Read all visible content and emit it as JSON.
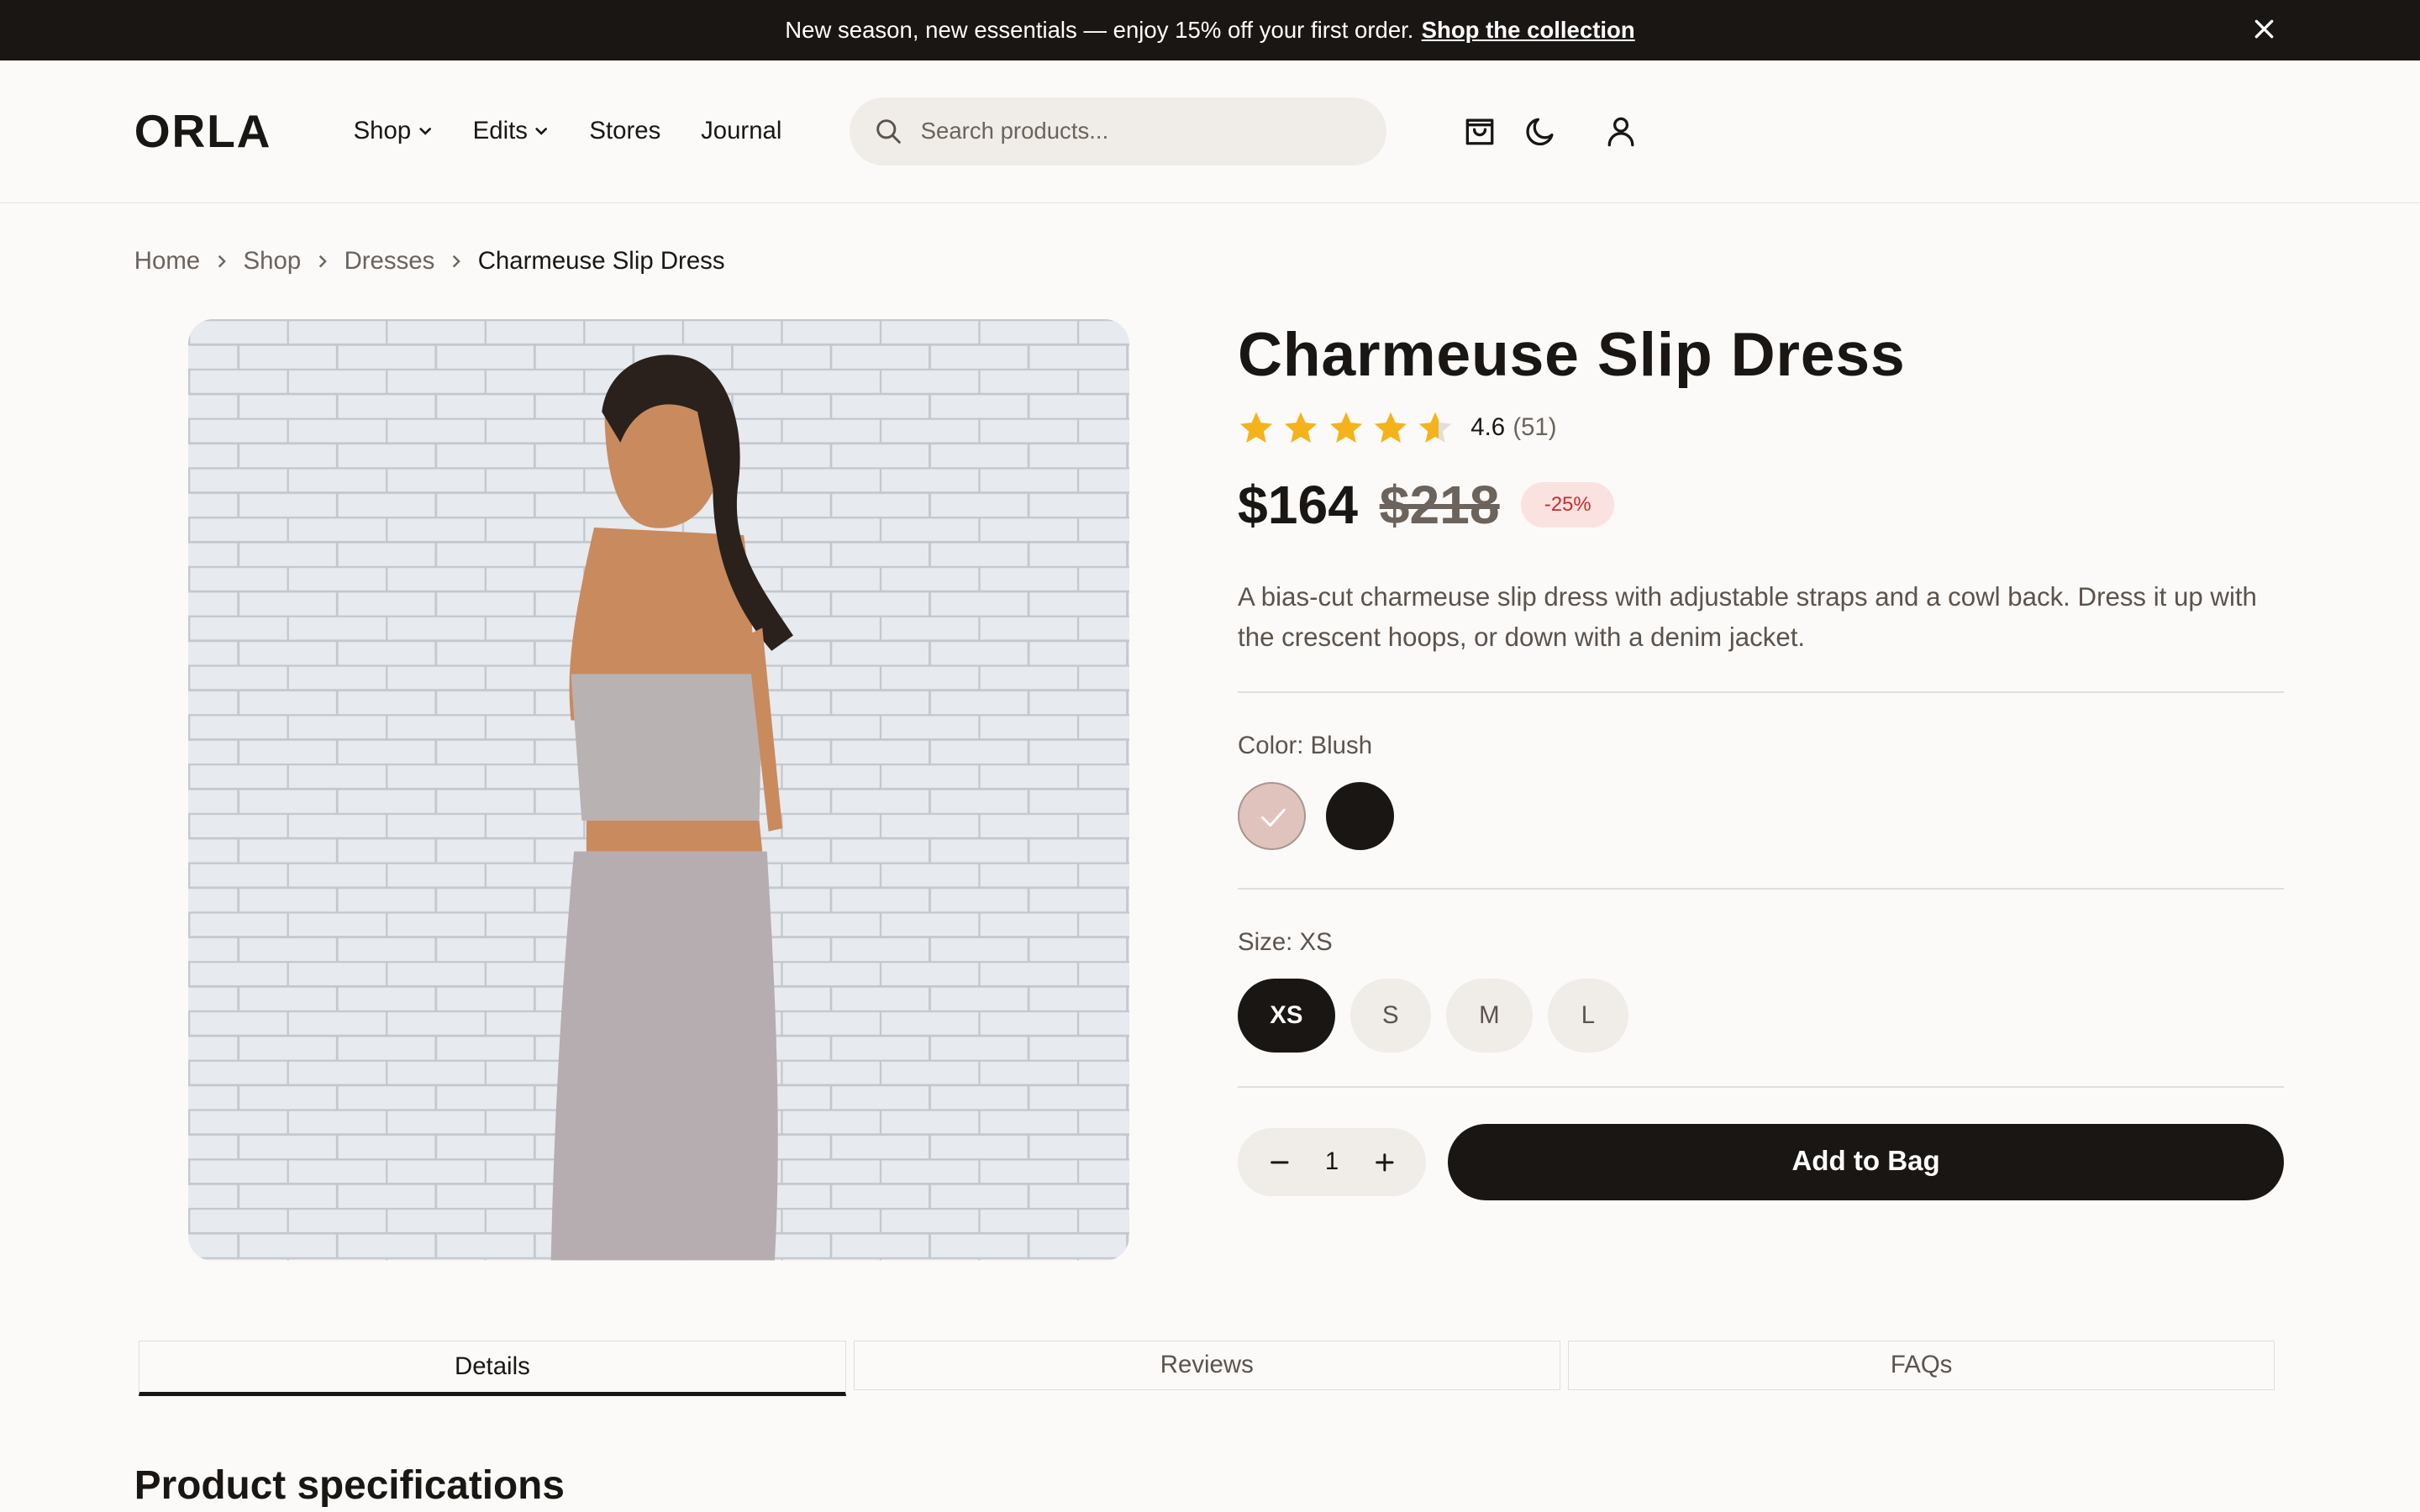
{
  "announcement": {
    "text": "New season, new essentials — enjoy 15% off your first order.",
    "link": "Shop the collection",
    "close_icon": "close-icon"
  },
  "header": {
    "logo": "ORLA",
    "nav": [
      {
        "label": "Shop",
        "has_dropdown": true
      },
      {
        "label": "Edits",
        "has_dropdown": true
      },
      {
        "label": "Stores",
        "has_dropdown": false
      },
      {
        "label": "Journal",
        "has_dropdown": false
      }
    ],
    "search": {
      "placeholder": "Search products...",
      "value": ""
    },
    "icons": [
      "shopping-bag-icon",
      "moon-icon",
      "user-icon"
    ]
  },
  "breadcrumb": [
    "Home",
    "Shop",
    "Dresses",
    "Charmeuse Slip Dress"
  ],
  "product": {
    "title": "Charmeuse Slip Dress",
    "rating": 4.6,
    "rating_text": "4.6",
    "reviews_count": "(51)",
    "price": "$164",
    "old_price": "$218",
    "discount": "-25%",
    "description": "A bias-cut charmeuse slip dress with adjustable straps and a cowl back. Dress it up with the crescent hoops, or down with a denim jacket.",
    "color_label": "Color: Blush",
    "colors": [
      {
        "name": "Blush",
        "hex": "#e0c3bd",
        "selected": true
      },
      {
        "name": "Black",
        "hex": "#1a1613",
        "selected": false
      }
    ],
    "size_label": "Size: XS",
    "sizes": [
      {
        "label": "XS",
        "selected": true
      },
      {
        "label": "S",
        "selected": false
      },
      {
        "label": "M",
        "selected": false
      },
      {
        "label": "L",
        "selected": false
      }
    ],
    "quantity": "1",
    "add_to_bag": "Add to Bag"
  },
  "tabs": [
    {
      "label": "Details",
      "active": true
    },
    {
      "label": "Reviews",
      "active": false
    },
    {
      "label": "FAQs",
      "active": false
    }
  ],
  "section_title": "Product specifications",
  "colors": {
    "dark": "#1a1613",
    "star": "#f5b31b",
    "discount_bg": "#f9e2e0",
    "discount_text": "#c62d28",
    "chip_bg": "#f0ede8"
  }
}
